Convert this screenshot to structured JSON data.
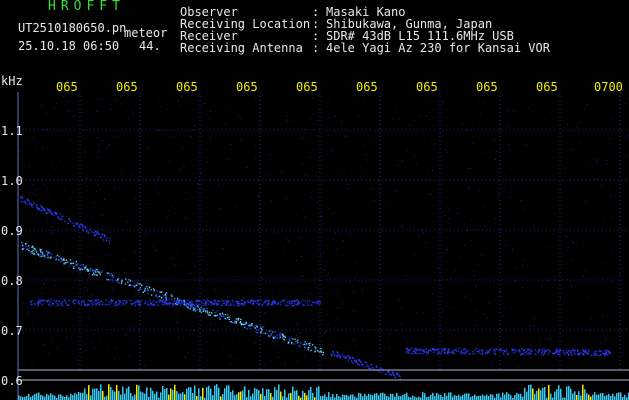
{
  "header": {
    "app_title": "HROFFT",
    "file_name": "UT2510180650.pn",
    "meteor_label": "meteor",
    "datetime": "25.10.18 06:50",
    "count": "44."
  },
  "metadata": {
    "rows": [
      {
        "label": "Observer",
        "sep": ":",
        "value": "Masaki Kano"
      },
      {
        "label": "Receiving Location",
        "sep": ":",
        "value": "Shibukawa, Gunma, Japan"
      },
      {
        "label": "Receiver",
        "sep": ":",
        "value": "SDR# 43dB L15 111.6MHz USB"
      },
      {
        "label": "Receiving Antenna",
        "sep": ":",
        "value": "4ele Yagi Az 230 for Kansai VOR"
      }
    ]
  },
  "spectrogram": {
    "freq_unit": "kHz",
    "freq_ticks": [
      "1.1",
      "1.0",
      "0.9",
      "0.8",
      "0.7",
      "0.6"
    ],
    "time_ticks": [
      "065",
      "065",
      "065",
      "065",
      "065",
      "065",
      "065",
      "065",
      "065",
      "0700"
    ],
    "colors": {
      "background": "#000000",
      "grid": "#1a2a9a",
      "signal_dim": "#2a3cff",
      "signal_bright": "#6fe8ff",
      "baseline_yellow": "#f0f000"
    }
  }
}
